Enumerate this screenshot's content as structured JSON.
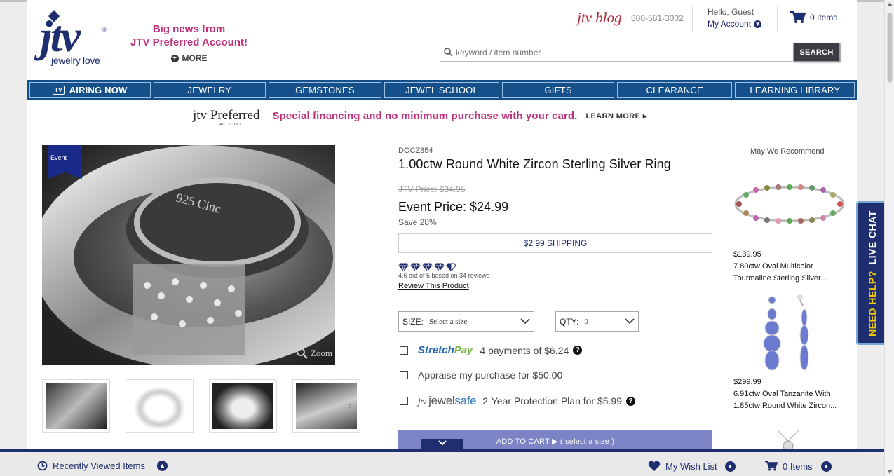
{
  "header": {
    "logo_text": "jtv",
    "logo_sub": "jewelry love",
    "promo_line1": "Big news from",
    "promo_line2": "JTV Preferred Account!",
    "promo_more": "MORE",
    "blog": "jtv blog",
    "phone": "800-581-3002",
    "hello": "Hello, Guest",
    "account": "My Account",
    "cart": "0 Items",
    "search_placeholder": "keyword / item number",
    "search_button": "SEARCH"
  },
  "nav": {
    "airing": "AIRING NOW",
    "tv": "TV",
    "items": [
      "JEWELRY",
      "GEMSTONES",
      "JEWEL SCHOOL",
      "GIFTS",
      "CLEARANCE",
      "LEARNING LIBRARY"
    ]
  },
  "preferred": {
    "brand": "jtv Preferred",
    "brand_sub": "ACCOUNT",
    "text": "Special financing and no minimum purchase with your card.",
    "learn": "LEARN MORE ▸"
  },
  "gallery": {
    "badge": "Event",
    "zoom": "Zoom"
  },
  "product": {
    "sku": "DOCZ854",
    "title": "1.00ctw Round White Zircon Sterling Silver Ring",
    "old_price": "JTV Price: $34.95",
    "event_price": "Event Price: $24.99",
    "save": "Save 28%",
    "shipping": "$2.99 SHIPPING",
    "rating_text": "4.6 out of 5 based on 34 reviews",
    "review_link": "Review This Product",
    "size_label": "SIZE:",
    "size_value": "Select a size",
    "qty_label": "QTY:",
    "qty_value": "0",
    "stretchpay_brand_a": "Stretch",
    "stretchpay_brand_b": "Pay",
    "stretchpay_text": "4 payments of $6.24",
    "appraise_text": "Appraise my purchase for $50.00",
    "jewelsafe_j": "jtv",
    "jewelsafe_a": "jewel",
    "jewelsafe_b": "safe",
    "jewelsafe_text": "2-Year Protection Plan for $5.99",
    "add_to_cart": "ADD TO CART ▶ ( select a size )"
  },
  "recommend": {
    "title": "May We Recommend",
    "items": [
      {
        "price": "$139.95",
        "name": "7.80ctw Oval Multicolor Tourmaline Sterling Silver..."
      },
      {
        "price": "$299.99",
        "name": "6.91ctw Oval Tanzanite With 1.85ctw Round White Zircon..."
      }
    ]
  },
  "livechat": {
    "a": "NEED HELP?",
    "b": "LIVE CHAT"
  },
  "bottom": {
    "recent": "Recently Viewed Items",
    "wishlist": "My Wish List",
    "cart": "0 Items"
  },
  "colors": {
    "navy": "#1f2e6e",
    "nav_blue": "#15508a",
    "magenta": "#c0307a"
  }
}
